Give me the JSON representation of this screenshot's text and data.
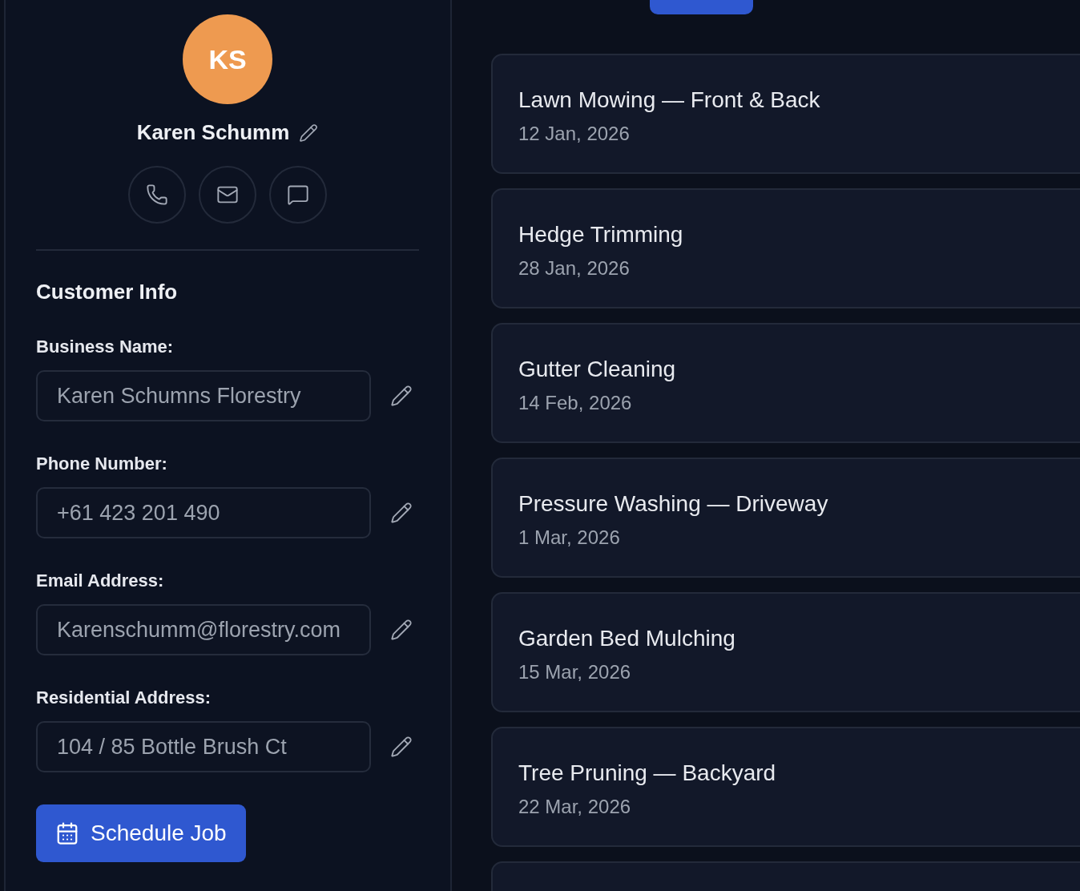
{
  "profile": {
    "initials": "KS",
    "name": "Karen Schumm"
  },
  "section_title": "Customer Info",
  "fields": [
    {
      "label": "Business Name:",
      "value": "Karen Schumns Florestry"
    },
    {
      "label": "Phone Number:",
      "value": "+61 423 201 490"
    },
    {
      "label": "Email Address:",
      "value": "Karenschumm@florestry.com"
    },
    {
      "label": "Residential Address:",
      "value": "104 / 85 Bottle Brush Ct"
    }
  ],
  "schedule_button": "Schedule Job",
  "jobs": [
    {
      "title": "Lawn Mowing — Front & Back",
      "date": "12 Jan, 2026"
    },
    {
      "title": "Hedge Trimming",
      "date": "28 Jan, 2026"
    },
    {
      "title": "Gutter Cleaning",
      "date": "14 Feb, 2026"
    },
    {
      "title": "Pressure Washing — Driveway",
      "date": "1 Mar, 2026"
    },
    {
      "title": "Garden Bed Mulching",
      "date": "15 Mar, 2026"
    },
    {
      "title": "Tree Pruning — Backyard",
      "date": "22 Mar, 2026"
    }
  ]
}
